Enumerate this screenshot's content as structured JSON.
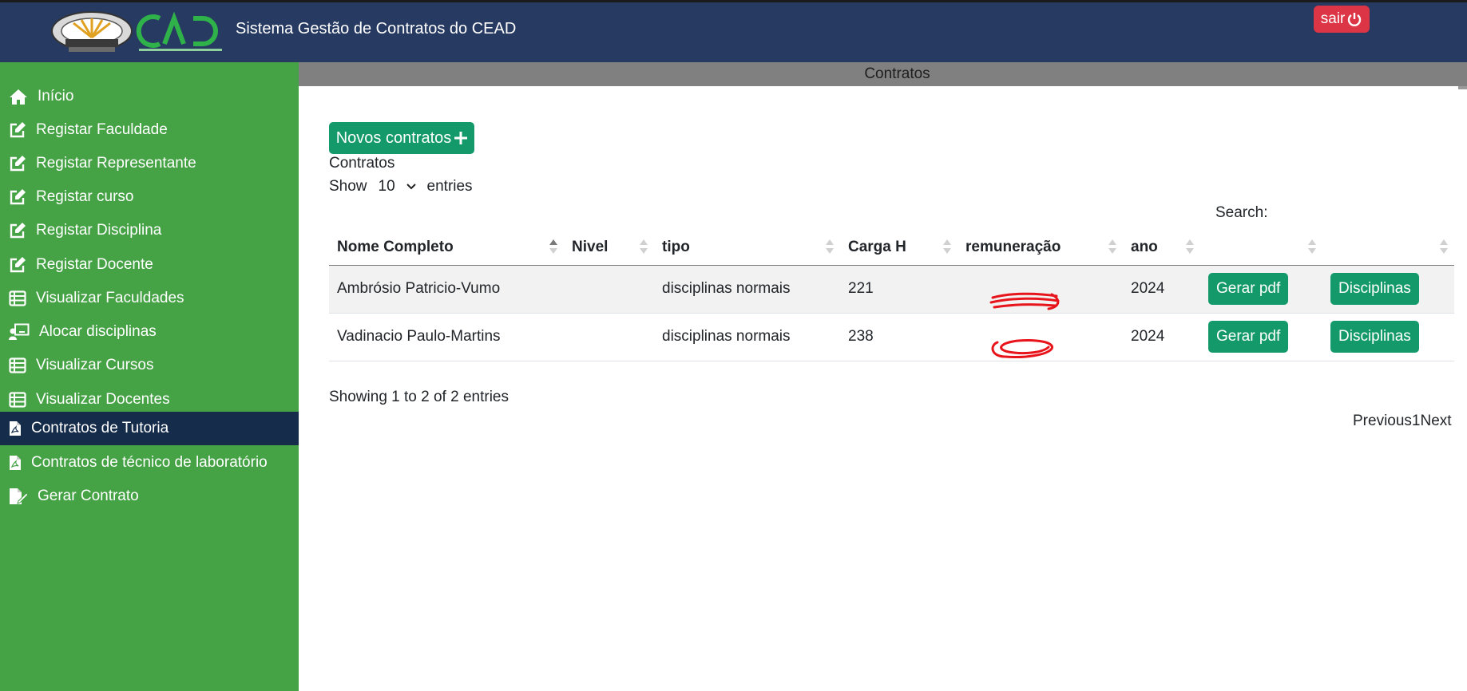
{
  "header": {
    "title": "Sistema Gestão de Contratos do CEAD",
    "logout_label": "sair",
    "colors": {
      "bar": "#273a61",
      "logout": "#dc3545"
    }
  },
  "sidebar": {
    "items": [
      {
        "label": "Início",
        "icon": "home-icon"
      },
      {
        "label": "Registar Faculdade",
        "icon": "edit-icon"
      },
      {
        "label": "Registar Representante",
        "icon": "edit-icon"
      },
      {
        "label": "Registar curso",
        "icon": "edit-icon"
      },
      {
        "label": "Registar Disciplina",
        "icon": "edit-icon"
      },
      {
        "label": "Registar Docente",
        "icon": "edit-icon"
      },
      {
        "label": "Visualizar Faculdades",
        "icon": "table-list-icon"
      },
      {
        "label": "Alocar disciplinas",
        "icon": "chalkboard-user-icon"
      },
      {
        "label": "Visualizar Cursos",
        "icon": "table-list-icon"
      },
      {
        "label": "Visualizar Docentes",
        "icon": "table-list-icon"
      },
      {
        "label": "Contratos de Tutoria",
        "icon": "file-pdf-icon",
        "active": true
      },
      {
        "label": "Contratos de técnico de laboratório",
        "icon": "file-pdf-icon"
      },
      {
        "label": "Gerar Contrato",
        "icon": "file-signature-icon"
      }
    ],
    "colors": {
      "bg": "#45a245",
      "active": "#152c4b"
    }
  },
  "main": {
    "section_title": "Contratos",
    "new_button_label": "Novos contratos",
    "table_caption": "Contratos",
    "length": {
      "show_label": "Show",
      "value": "10",
      "entries_label": "entries"
    },
    "search_label": "Search:",
    "columns": [
      "Nome Completo",
      "Nivel",
      "tipo",
      "Carga H",
      "remuneração",
      "ano",
      "",
      ""
    ],
    "rows": [
      {
        "nome": "Ambrósio Patricio-Vumo",
        "nivel": "",
        "tipo": "disciplinas normais",
        "carga": "221",
        "ano": "2024",
        "pdf_label": "Gerar pdf",
        "disc_label": "Disciplinas"
      },
      {
        "nome": "Vadinacio Paulo-Martins",
        "nivel": "",
        "tipo": "disciplinas normais",
        "carga": "238",
        "ano": "2024",
        "pdf_label": "Gerar pdf",
        "disc_label": "Disciplinas"
      }
    ],
    "info": "Showing 1 to 2 of 2 entries",
    "pagination": {
      "previous": "Previous",
      "page": "1",
      "next": "Next"
    },
    "colors": {
      "button": "#149a6a",
      "redaction": "#e8141b"
    }
  }
}
